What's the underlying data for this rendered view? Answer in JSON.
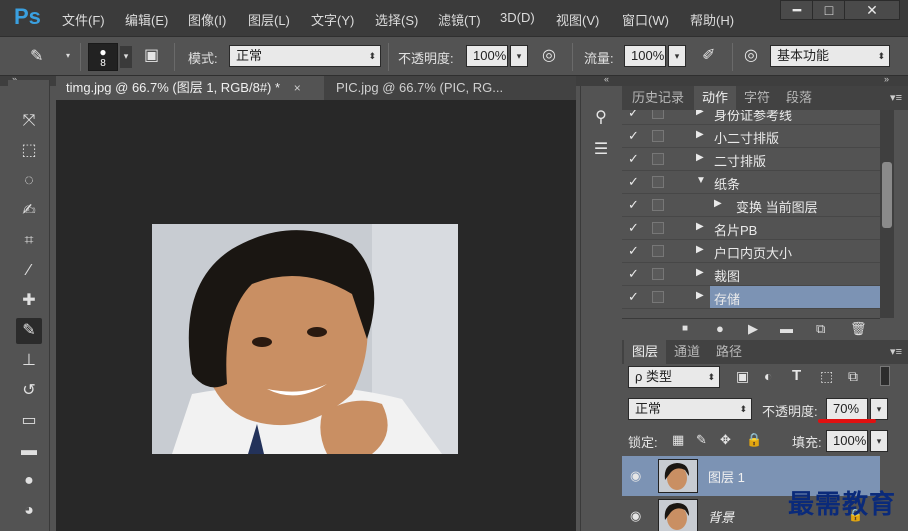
{
  "app": {
    "logo": "Ps"
  },
  "menu": [
    "文件(F)",
    "编辑(E)",
    "图像(I)",
    "图层(L)",
    "文字(Y)",
    "选择(S)",
    "滤镜(T)",
    "3D(D)",
    "视图(V)",
    "窗口(W)",
    "帮助(H)"
  ],
  "window_controls": {
    "minimize": "━",
    "maximize": "□",
    "close": "✕"
  },
  "options": {
    "brush_size": "8",
    "mode_label": "模式:",
    "mode_value": "正常",
    "opacity_label": "不透明度:",
    "opacity_value": "100%",
    "flow_label": "流量:",
    "flow_value": "100%",
    "workspace_value": "基本功能"
  },
  "documents": [
    {
      "title": "timg.jpg @ 66.7% (图层 1, RGB/8#) *",
      "close": "×"
    },
    {
      "title": "PIC.jpg @ 66.7% (PIC, RG...",
      "close": "×"
    }
  ],
  "actions_panel": {
    "tabs": [
      "历史记录",
      "动作",
      "字符",
      "段落"
    ],
    "active_tab": "动作",
    "items": [
      {
        "check": "✓",
        "label": "身份证参考线",
        "expanded": false,
        "indent": 0
      },
      {
        "check": "✓",
        "label": "小二寸排版",
        "expanded": false,
        "indent": 0
      },
      {
        "check": "✓",
        "label": "二寸排版",
        "expanded": false,
        "indent": 0
      },
      {
        "check": "✓",
        "label": "纸条",
        "expanded": true,
        "indent": 0
      },
      {
        "check": "✓",
        "label": "变换 当前图层",
        "expanded": false,
        "indent": 1
      },
      {
        "check": "✓",
        "label": "名片PB",
        "expanded": false,
        "indent": 0
      },
      {
        "check": "✓",
        "label": "户口内页大小",
        "expanded": false,
        "indent": 0
      },
      {
        "check": "✓",
        "label": "裁图",
        "expanded": false,
        "indent": 0
      },
      {
        "check": "✓",
        "label": "存储",
        "expanded": false,
        "indent": 0,
        "selected": true
      }
    ]
  },
  "layers_panel": {
    "tabs": [
      "图层",
      "通道",
      "路径"
    ],
    "active_tab": "图层",
    "filter_label": "ρ 类型",
    "blend_mode": "正常",
    "opacity_label": "不透明度:",
    "opacity_value": "70%",
    "lock_label": "锁定:",
    "fill_label": "填充:",
    "fill_value": "100%",
    "layers": [
      {
        "name": "图层 1",
        "selected": true
      },
      {
        "name": "背景",
        "selected": false
      }
    ]
  },
  "watermark": "最需教育",
  "colors": {
    "accent_selected": "#7c93b4",
    "underline": "#e01010",
    "ps_blue": "#3aa0e0"
  }
}
